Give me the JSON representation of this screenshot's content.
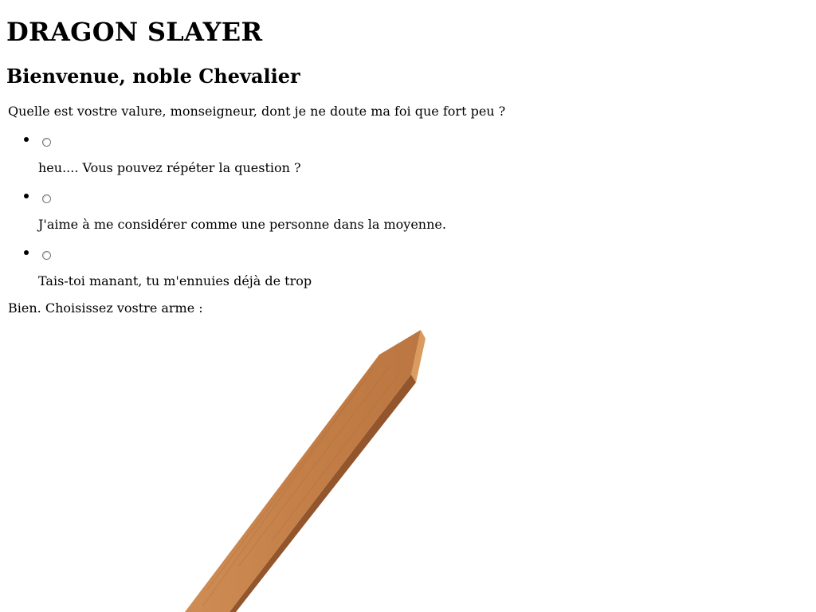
{
  "page": {
    "title": "DRAGON SLAYER",
    "subtitle": "Bienvenue, noble Chevalier",
    "question": "Quelle est vostre valure, monseigneur, dont je ne doute ma foi que fort peu ?",
    "answers": [
      {
        "label": "heu.... Vous pouvez répéter la question ?",
        "selected": false
      },
      {
        "label": "J'aime à me considérer comme une personne dans la moyenne.",
        "selected": false
      },
      {
        "label": "Tais-toi manant, tu m'ennuies déjà de trop",
        "selected": false
      }
    ],
    "weapon_prompt": "Bien. Choisissez vostre arme :"
  },
  "weapon": {
    "icon": "wooden-stick-icon",
    "colors": {
      "face": "#c47f48",
      "highlight": "#d6975c",
      "shadow": "#93552b",
      "edge": "#e0a467"
    }
  }
}
